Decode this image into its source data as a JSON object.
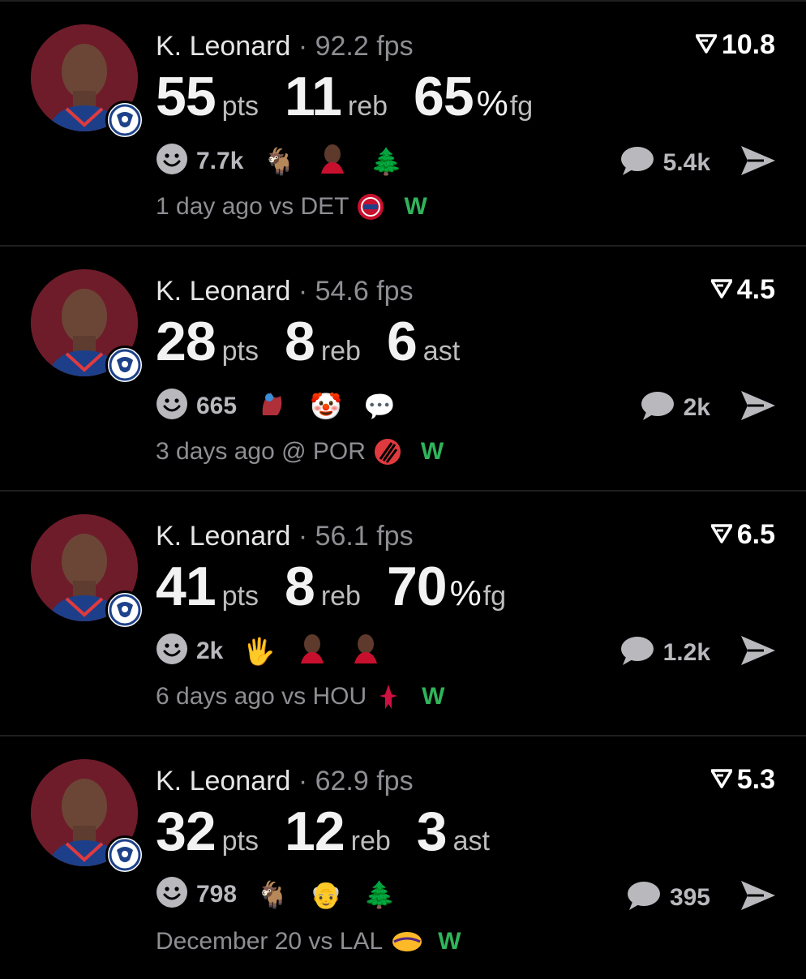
{
  "colors": {
    "background": "#000000",
    "win": "#2fb45a",
    "muted": "#8e8e93"
  },
  "cards": [
    {
      "player": "K. Leonard",
      "sep": "·",
      "fps": "92.2 fps",
      "score": "10.8",
      "stats": [
        {
          "num": "55",
          "unit": "pts"
        },
        {
          "num": "11",
          "unit": "reb"
        },
        {
          "num": "65",
          "pct": "%",
          "unit": "fg"
        }
      ],
      "reactions": {
        "count": "7.7k",
        "emojis": [
          "🐐",
          "kawhi-face",
          "🌲"
        ]
      },
      "comments": "5.4k",
      "footer": {
        "when": "1 day ago vs DET",
        "result": "W",
        "opponent_logo": "pistons-logo"
      }
    },
    {
      "player": "K. Leonard",
      "sep": "·",
      "fps": "54.6 fps",
      "score": "4.5",
      "stats": [
        {
          "num": "28",
          "unit": "pts"
        },
        {
          "num": "8",
          "unit": "reb"
        },
        {
          "num": "6",
          "unit": "ast"
        }
      ],
      "reactions": {
        "count": "665",
        "emojis": [
          "fire-dragon",
          "🤡",
          "💬"
        ]
      },
      "comments": "2k",
      "footer": {
        "when": "3 days ago @ POR",
        "result": "W",
        "opponent_logo": "blazers-logo"
      }
    },
    {
      "player": "K. Leonard",
      "sep": "·",
      "fps": "56.1 fps",
      "score": "6.5",
      "stats": [
        {
          "num": "41",
          "unit": "pts"
        },
        {
          "num": "8",
          "unit": "reb"
        },
        {
          "num": "70",
          "pct": "%",
          "unit": "fg"
        }
      ],
      "reactions": {
        "count": "2k",
        "emojis": [
          "🖐",
          "kawhi-face",
          "kawhi-face-2"
        ]
      },
      "comments": "1.2k",
      "footer": {
        "when": "6 days ago vs HOU",
        "result": "W",
        "opponent_logo": "rockets-logo"
      }
    },
    {
      "player": "K. Leonard",
      "sep": "·",
      "fps": "62.9 fps",
      "score": "5.3",
      "stats": [
        {
          "num": "32",
          "unit": "pts"
        },
        {
          "num": "12",
          "unit": "reb"
        },
        {
          "num": "3",
          "unit": "ast"
        }
      ],
      "reactions": {
        "count": "798",
        "emojis": [
          "🐐",
          "👴",
          "🌲"
        ]
      },
      "comments": "395",
      "footer": {
        "when": "December 20 vs LAL",
        "result": "W",
        "opponent_logo": "lakers-logo"
      }
    }
  ]
}
